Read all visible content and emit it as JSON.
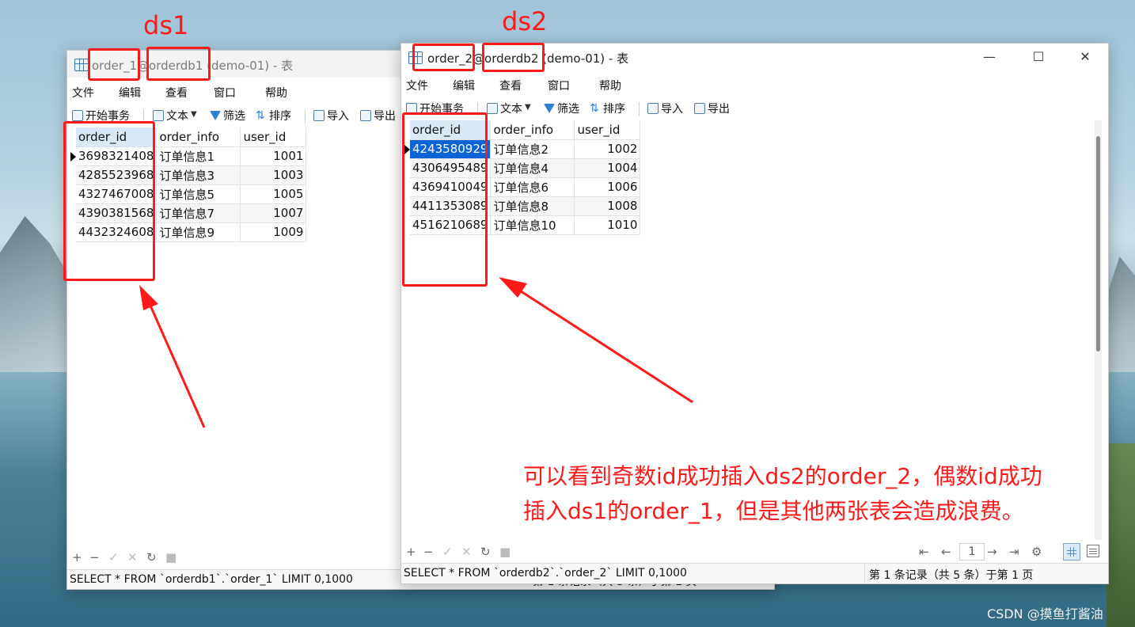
{
  "windows": [
    {
      "title_parts": [
        "order_1",
        "@",
        "orderdb1",
        " (demo-01) - 表"
      ],
      "menu": [
        "文件",
        "编辑",
        "查看",
        "窗口",
        "帮助"
      ],
      "toolbar": [
        "开始事务",
        "文本",
        "筛选",
        "排序",
        "导入",
        "导出"
      ],
      "columns": [
        "order_id",
        "order_info",
        "user_id"
      ],
      "rows": [
        [
          "3698321408",
          "订单信息1",
          "1001"
        ],
        [
          "4285523968",
          "订单信息3",
          "1003"
        ],
        [
          "4327467008",
          "订单信息5",
          "1005"
        ],
        [
          "4390381568",
          "订单信息7",
          "1007"
        ],
        [
          "4432324608",
          "订单信息9",
          "1009"
        ]
      ],
      "status_sql": "SELECT * FROM `orderdb1`.`order_1` LIMIT 0,1000",
      "status_records": "第 1 条记录（共 5 条）于第 1 页"
    },
    {
      "title_parts": [
        "order_2",
        "@",
        "orderdb2",
        " (demo-01) - 表"
      ],
      "menu": [
        "文件",
        "编辑",
        "查看",
        "窗口",
        "帮助"
      ],
      "toolbar": [
        "开始事务",
        "文本",
        "筛选",
        "排序",
        "导入",
        "导出"
      ],
      "columns": [
        "order_id",
        "order_info",
        "user_id"
      ],
      "rows": [
        [
          "4243580929",
          "订单信息2",
          "1002"
        ],
        [
          "4306495489",
          "订单信息4",
          "1004"
        ],
        [
          "4369410049",
          "订单信息6",
          "1006"
        ],
        [
          "4411353089",
          "订单信息8",
          "1008"
        ],
        [
          "4516210689",
          "订单信息10",
          "1010"
        ]
      ],
      "status_sql": "SELECT * FROM `orderdb2`.`order_2` LIMIT 0,1000",
      "status_records": "第 1 条记录（共 5 条）于第 1 页",
      "page_number": "1"
    }
  ],
  "window_controls": [
    "—",
    "☐",
    "✕"
  ],
  "bottom_controls": [
    "+",
    "−",
    "✓",
    "✕",
    "↻",
    "■"
  ],
  "pager_controls": [
    "⇤",
    "←",
    "→",
    "⇥",
    "⚙"
  ],
  "annotations": {
    "ds1": "ds1",
    "ds2": "ds2",
    "note_line1": "可以看到奇数id成功插入ds2的order_2，偶数id成功",
    "note_line2": "插入ds1的order_1，但是其他两张表会造成浪费。",
    "color": "#ff1a1a"
  },
  "watermark": "CSDN @摸鱼打酱油"
}
